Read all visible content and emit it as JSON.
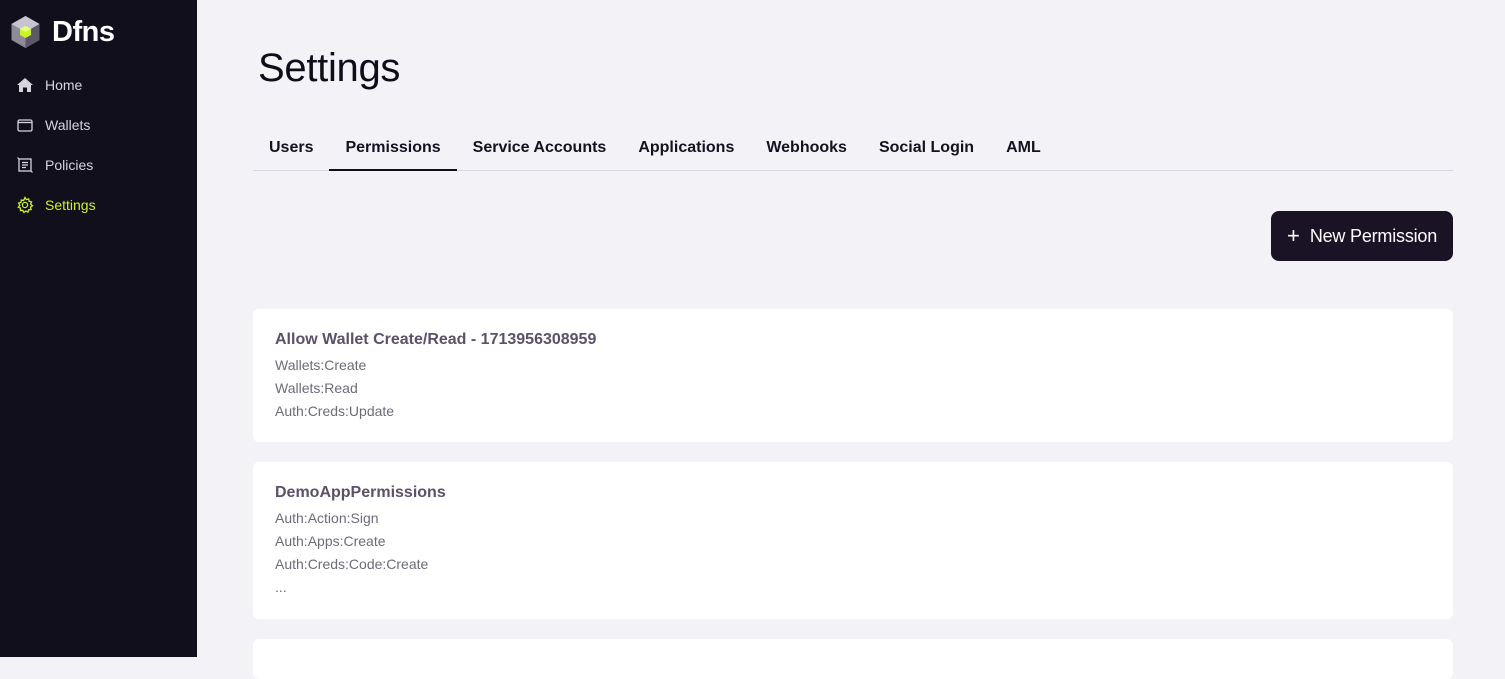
{
  "brand": {
    "name": "Dfns"
  },
  "sidebar": {
    "items": [
      {
        "label": "Home",
        "icon": "home-icon"
      },
      {
        "label": "Wallets",
        "icon": "wallet-icon"
      },
      {
        "label": "Policies",
        "icon": "policies-icon"
      },
      {
        "label": "Settings",
        "icon": "gear-icon",
        "active": true
      }
    ]
  },
  "page": {
    "title": "Settings"
  },
  "tabs": [
    {
      "label": "Users"
    },
    {
      "label": "Permissions",
      "active": true
    },
    {
      "label": "Service Accounts"
    },
    {
      "label": "Applications"
    },
    {
      "label": "Webhooks"
    },
    {
      "label": "Social Login"
    },
    {
      "label": "AML"
    }
  ],
  "actions": {
    "new_permission": {
      "icon": "+",
      "label": "New Permission"
    }
  },
  "permissions": [
    {
      "title": "Allow Wallet Create/Read - 1713956308959",
      "lines": [
        "Wallets:Create",
        "Wallets:Read",
        "Auth:Creds:Update"
      ]
    },
    {
      "title": "DemoAppPermissions",
      "lines": [
        "Auth:Action:Sign",
        "Auth:Apps:Create",
        "Auth:Creds:Code:Create",
        "..."
      ]
    }
  ],
  "colors": {
    "sidebar_bg": "#120f1d",
    "accent_active": "#c9f227",
    "button_bg": "#1a1326",
    "card_title": "#5b5168"
  }
}
